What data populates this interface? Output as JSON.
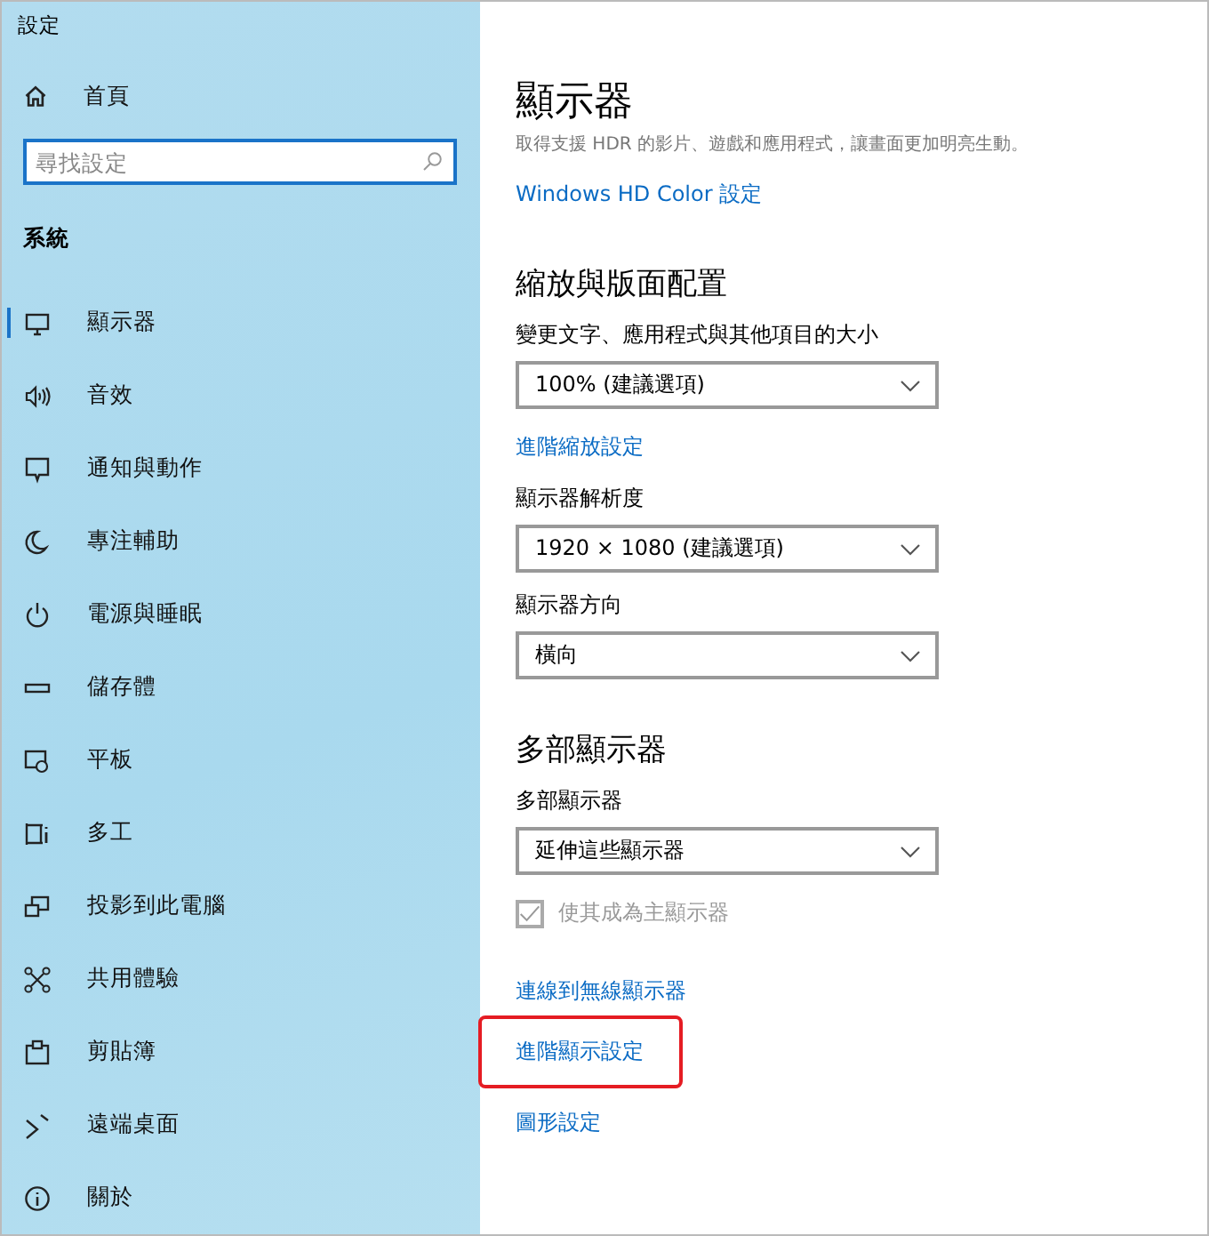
{
  "window": {
    "title": "設定"
  },
  "sidebar": {
    "home": "首頁",
    "search": {
      "placeholder": "尋找設定"
    },
    "section": "系統",
    "items": [
      {
        "label": "顯示器",
        "selected": true
      },
      {
        "label": "音效",
        "selected": false
      },
      {
        "label": "通知與動作",
        "selected": false
      },
      {
        "label": "專注輔助",
        "selected": false
      },
      {
        "label": "電源與睡眠",
        "selected": false
      },
      {
        "label": "儲存體",
        "selected": false
      },
      {
        "label": "平板",
        "selected": false
      },
      {
        "label": "多工",
        "selected": false
      },
      {
        "label": "投影到此電腦",
        "selected": false
      },
      {
        "label": "共用體驗",
        "selected": false
      },
      {
        "label": "剪貼簿",
        "selected": false
      },
      {
        "label": "遠端桌面",
        "selected": false
      },
      {
        "label": "關於",
        "selected": false
      }
    ]
  },
  "content": {
    "title": "顯示器",
    "description": "取得支援 HDR 的影片、遊戲和應用程式，讓畫面更加明亮生動。",
    "blocks": [
      {
        "kind": "link",
        "text": "Windows HD Color 設定",
        "highlighted": false
      },
      {
        "kind": "heading",
        "text": "縮放與版面配置"
      },
      {
        "kind": "dropdown",
        "label": "變更文字、應用程式與其他項目的大小",
        "value": "100% (建議選項)"
      },
      {
        "kind": "link",
        "text": "進階縮放設定",
        "highlighted": false
      },
      {
        "kind": "dropdown",
        "label": "顯示器解析度",
        "value": "1920 × 1080 (建議選項)"
      },
      {
        "kind": "dropdown",
        "label": "顯示器方向",
        "value": "橫向"
      },
      {
        "kind": "heading",
        "text": "多部顯示器"
      },
      {
        "kind": "dropdown",
        "label": "多部顯示器",
        "value": "延伸這些顯示器"
      },
      {
        "kind": "checkbox",
        "text": "使其成為主顯示器",
        "checked": true,
        "disabled": true
      },
      {
        "kind": "link",
        "text": "連線到無線顯示器",
        "highlighted": false
      },
      {
        "kind": "link",
        "text": "進階顯示設定",
        "highlighted": true
      },
      {
        "kind": "link",
        "text": "圖形設定",
        "highlighted": false
      }
    ]
  }
}
